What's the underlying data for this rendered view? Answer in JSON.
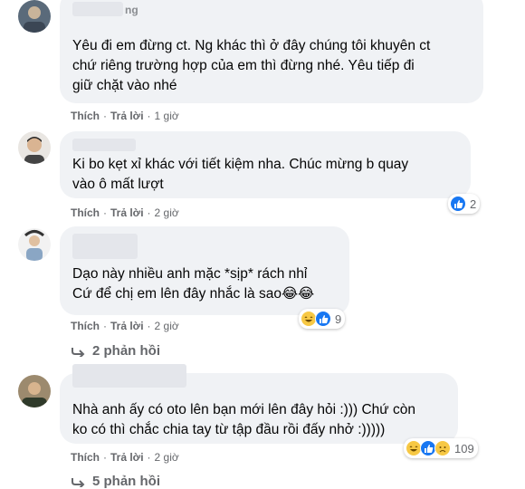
{
  "comments": [
    {
      "name_fragment": "ng",
      "text": "Yêu đi em đừng ct. Ng khác thì ở đây chúng tôi khuyên ct\nchứ riêng trường hợp của em thì đừng nhé. Yêu tiếp đi\ngiữ chặt vào nhé",
      "like": "Thích",
      "reply": "Trả lời",
      "time": "1 giờ"
    },
    {
      "text": "Ki bo kẹt xỉ khác với tiết kiệm nha. Chúc mừng b quay\nvào ô mất lượt",
      "like": "Thích",
      "reply": "Trả lời",
      "time": "2 giờ",
      "reaction_count": "2",
      "reactions": [
        "like-icon"
      ]
    },
    {
      "text": "Dạo này nhiều anh mặc *sịp* rách nhỉ\nCứ để chị em lên đây nhắc là sao😂😂",
      "like": "Thích",
      "reply": "Trả lời",
      "time": "2 giờ",
      "reaction_count": "9",
      "reactions": [
        "haha-icon",
        "like-icon"
      ],
      "replies_label": "2 phản hồi"
    },
    {
      "text": "Nhà anh ấy có oto lên bạn mới lên đây hỏi :))) Chứ còn\nko có thì chắc chia tay từ tập đầu rồi đấy nhở :)))))",
      "like": "Thích",
      "reply": "Trả lời",
      "time": "2 giờ",
      "reaction_count": "109",
      "reactions": [
        "haha-icon",
        "like-icon",
        "sad-icon"
      ],
      "replies_label": "5 phản hồi"
    }
  ],
  "colors": {
    "bubble": "#f0f2f5",
    "meta": "#65676b",
    "like": "#1877f2",
    "haha": "#f7c844"
  }
}
